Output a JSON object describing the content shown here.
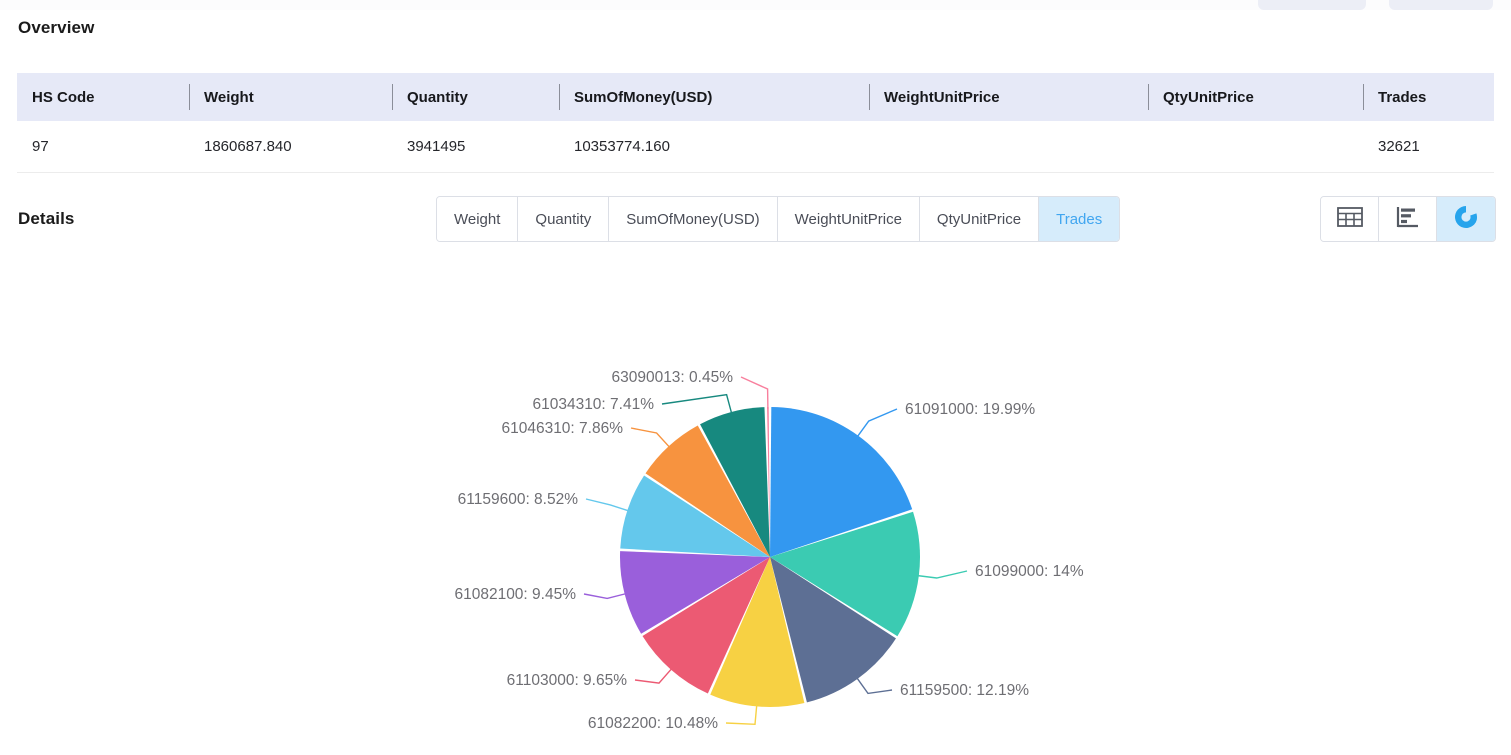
{
  "top_chips": [
    "",
    ""
  ],
  "overview": {
    "title": "Overview",
    "columns": [
      "HS Code",
      "Weight",
      "Quantity",
      "SumOfMoney(USD)",
      "WeightUnitPrice",
      "QtyUnitPrice",
      "Trades"
    ],
    "rows": [
      {
        "hs_code": "97",
        "weight": "1860687.840",
        "quantity": "3941495",
        "sum_of_money": "10353774.160",
        "weight_unit_price": "",
        "qty_unit_price": "",
        "trades": "32621"
      }
    ]
  },
  "details": {
    "title": "Details",
    "metric_tabs": [
      {
        "label": "Weight",
        "active": false
      },
      {
        "label": "Quantity",
        "active": false
      },
      {
        "label": "SumOfMoney(USD)",
        "active": false
      },
      {
        "label": "WeightUnitPrice",
        "active": false
      },
      {
        "label": "QtyUnitPrice",
        "active": false
      },
      {
        "label": "Trades",
        "active": true
      }
    ],
    "view_buttons": [
      {
        "icon": "table-grid-icon",
        "active": false
      },
      {
        "icon": "bar-chart-icon",
        "active": false
      },
      {
        "icon": "donut-chart-icon",
        "active": true
      }
    ],
    "active_metric": "Trades",
    "active_view": "donut-chart-icon"
  },
  "colors": {
    "accent_blue": "#41a6f0",
    "active_tab_bg": "#d6ecfb",
    "table_header_bg": "#e6e9f7",
    "label_text": "#6e6e73",
    "page_bg": "#ffffff"
  },
  "chart_data": {
    "type": "pie",
    "title": "",
    "value_label": "Trades",
    "legend": "labels-outside",
    "grid": false,
    "total_percent": 100,
    "labels": [
      "61091000",
      "61099000",
      "61159500",
      "61082200",
      "61103000",
      "61082100",
      "61159600",
      "61046310",
      "61034310",
      "63090013"
    ],
    "values": [
      19.99,
      14,
      12.19,
      10.48,
      9.65,
      9.45,
      8.52,
      7.86,
      7.41,
      0.45
    ],
    "unit": "%",
    "slice_colors": [
      "#3398f0",
      "#3bcbb2",
      "#5d6f94",
      "#f7d143",
      "#ec5a73",
      "#9a5fdb",
      "#64c8ec",
      "#f7933f",
      "#17897f",
      "#f87f9d"
    ],
    "annotations": [
      {
        "text": "61091000:  19.99%",
        "value": 19.99,
        "side": "right"
      },
      {
        "text": "61099000:  14%",
        "value": 14,
        "side": "right"
      },
      {
        "text": "61159500:  12.19%",
        "value": 12.19,
        "side": "right"
      },
      {
        "text": "61082200:  10.48%",
        "value": 10.48,
        "side": "left"
      },
      {
        "text": "61103000:  9.65%",
        "value": 9.65,
        "side": "left"
      },
      {
        "text": "61082100:  9.45%",
        "value": 9.45,
        "side": "left"
      },
      {
        "text": "61159600:  8.52%",
        "value": 8.52,
        "side": "left"
      },
      {
        "text": "61046310:  7.86%",
        "value": 7.86,
        "side": "left"
      },
      {
        "text": "61034310:  7.41%",
        "value": 7.41,
        "side": "left"
      },
      {
        "text": "63090013:  0.45%",
        "value": 0.45,
        "side": "left"
      }
    ]
  }
}
